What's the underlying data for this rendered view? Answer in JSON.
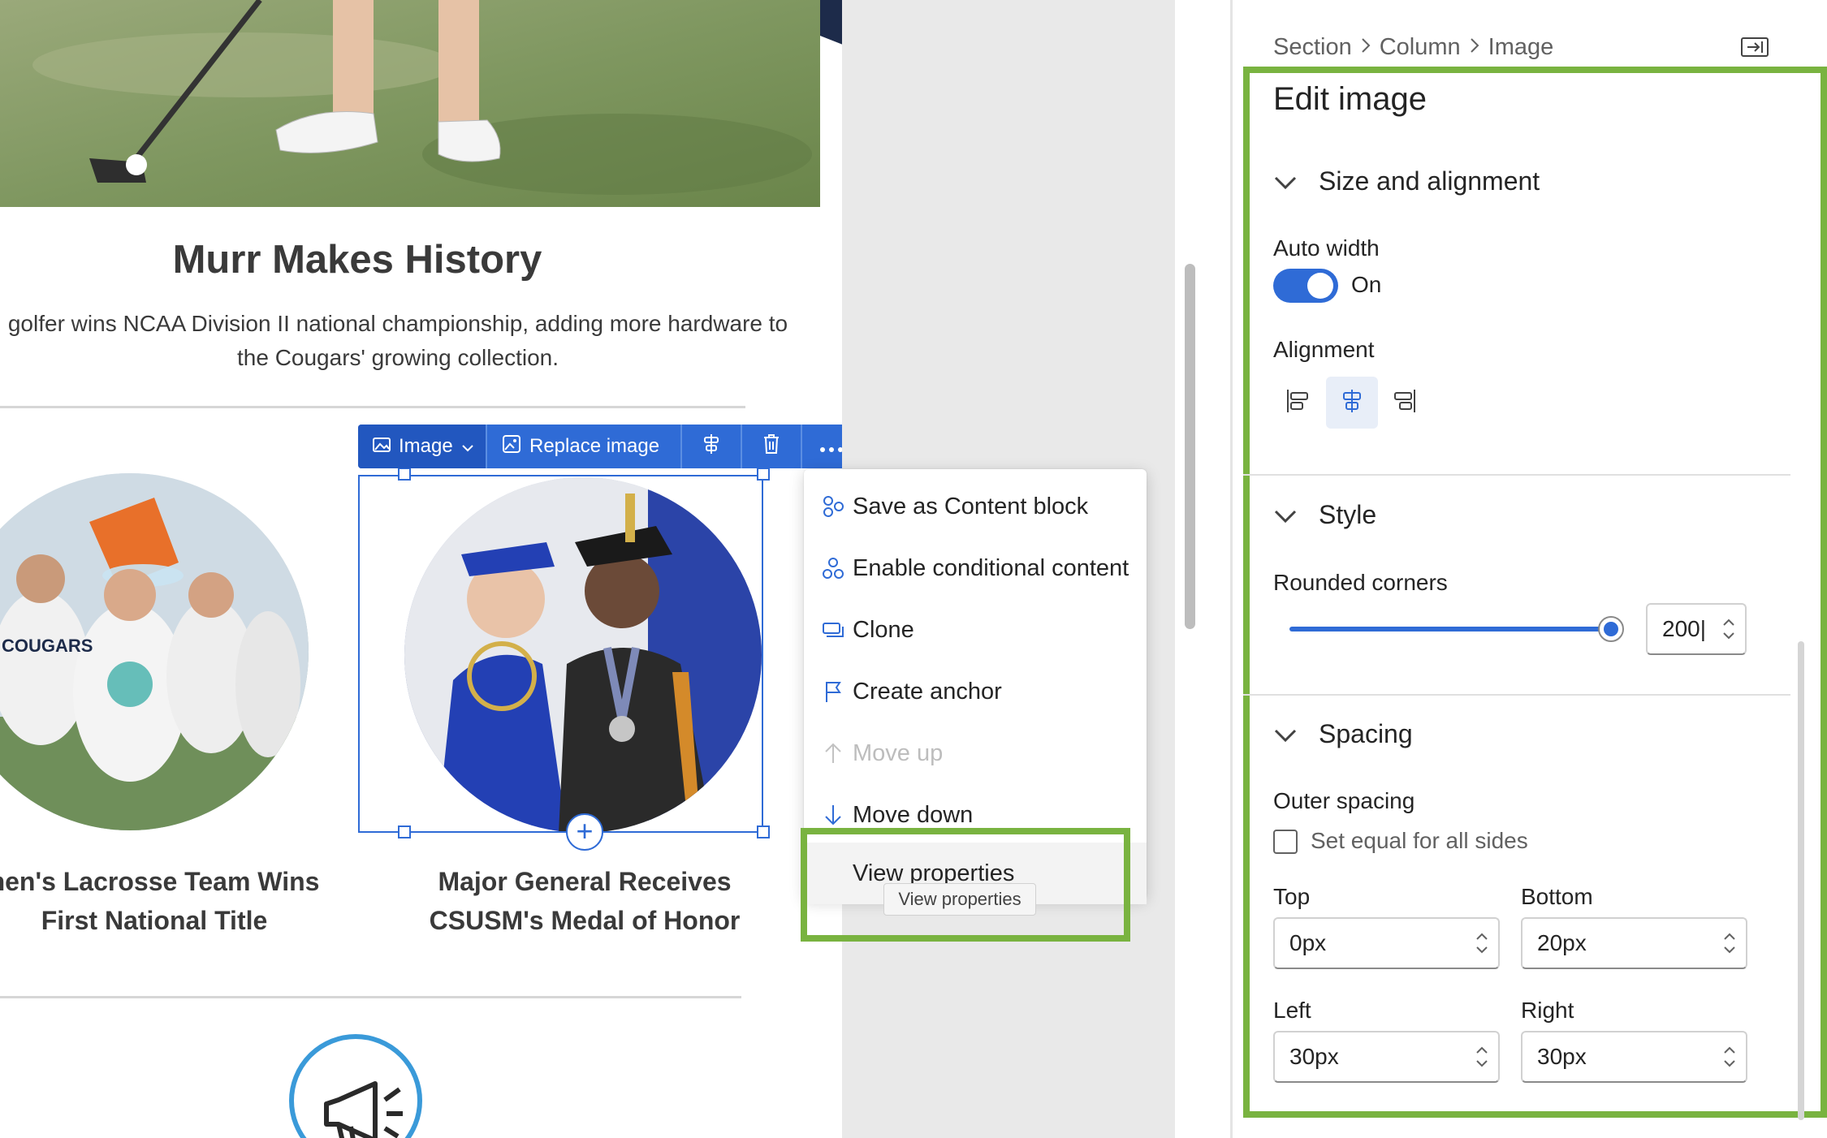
{
  "email_preview": {
    "headline": "Murr Makes History",
    "dek": "golfer wins NCAA Division II national championship, adding more hardware to the Cougars' growing collection.",
    "stories": [
      {
        "title": "nen's Lacrosse Team Wins First National Title"
      },
      {
        "title": "Major General Receives CSUSM's Medal of Honor"
      }
    ],
    "lacrosse_jersey_text": "COUGARS"
  },
  "image_toolbar": {
    "image_menu_label": "Image",
    "replace_label": "Replace image"
  },
  "context_menu": {
    "items": [
      {
        "label": "Save as Content block",
        "icon": "content-block-icon",
        "disabled": false
      },
      {
        "label": "Enable conditional content",
        "icon": "conditional-content-icon",
        "disabled": false
      },
      {
        "label": "Clone",
        "icon": "clone-icon",
        "disabled": false
      },
      {
        "label": "Create anchor",
        "icon": "flag-icon",
        "disabled": false
      },
      {
        "label": "Move up",
        "icon": "arrow-up-icon",
        "disabled": true
      },
      {
        "label": "Move down",
        "icon": "arrow-down-icon",
        "disabled": false
      },
      {
        "label": "View properties",
        "icon": "",
        "disabled": false
      }
    ],
    "tooltip": "View properties"
  },
  "properties_panel": {
    "breadcrumb": [
      "Section",
      "Column",
      "Image"
    ],
    "title": "Edit image",
    "size_section": {
      "heading": "Size and alignment",
      "auto_width_label": "Auto width",
      "auto_width_state": "On",
      "auto_width_on": true,
      "alignment_label": "Alignment",
      "alignment_selected": "center"
    },
    "style_section": {
      "heading": "Style",
      "rounded_corners_label": "Rounded corners",
      "rounded_corners_value": "200|",
      "rounded_corners_slider_fraction": 1.0
    },
    "spacing_section": {
      "heading": "Spacing",
      "outer_spacing_label": "Outer spacing",
      "equal_sides_label": "Set equal for all sides",
      "equal_sides_checked": false,
      "top_label": "Top",
      "top_value": "0px",
      "bottom_label": "Bottom",
      "bottom_value": "20px",
      "left_label": "Left",
      "left_value": "30px",
      "right_label": "Right",
      "right_value": "30px"
    }
  },
  "colors": {
    "accent": "#2f6bd6",
    "highlight": "#79b340"
  }
}
